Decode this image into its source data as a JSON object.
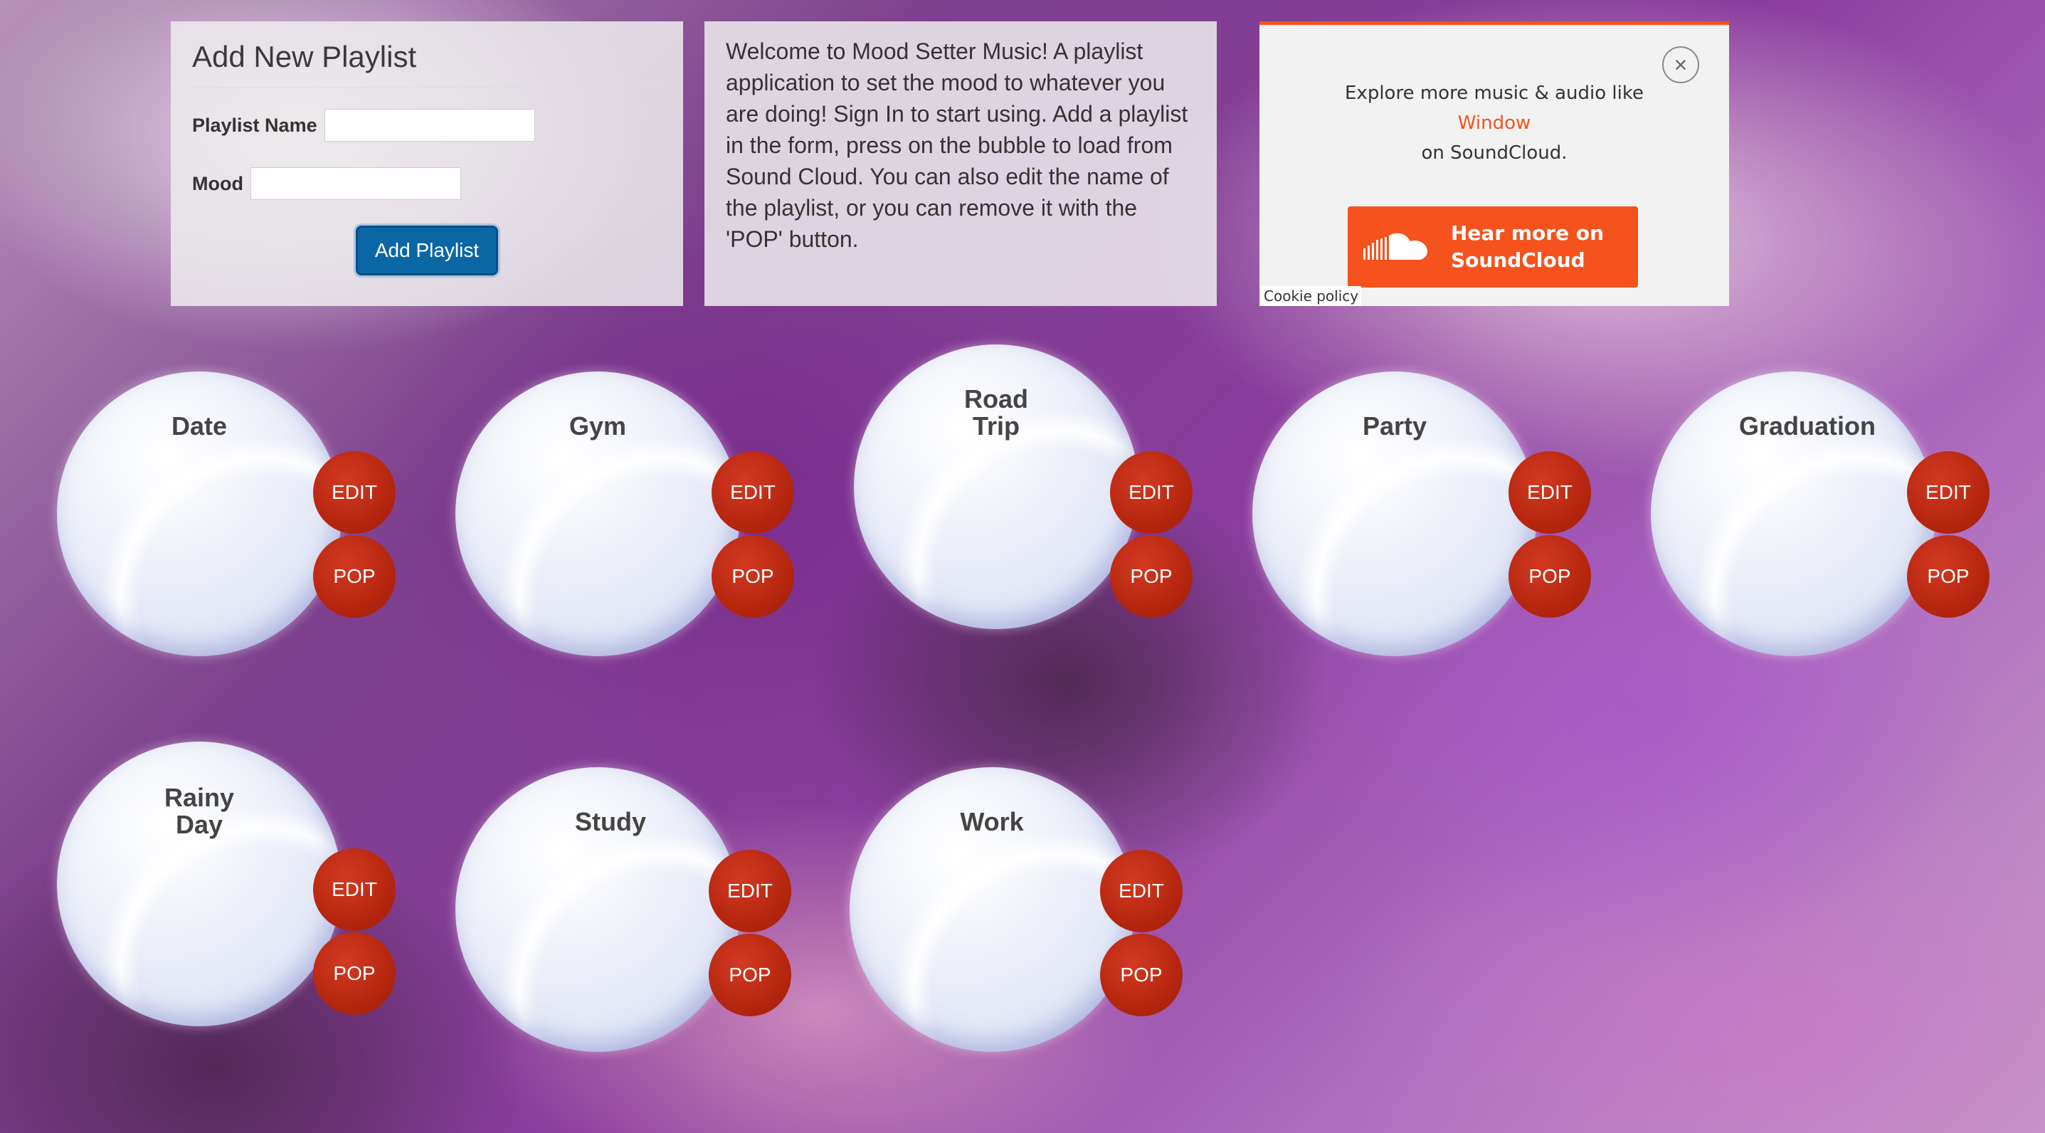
{
  "form": {
    "title": "Add New Playlist",
    "playlist_name_label": "Playlist Name",
    "playlist_name_value": "",
    "mood_label": "Mood",
    "mood_value": "",
    "add_button": "Add Playlist"
  },
  "info": {
    "text": "Welcome to Mood Setter Music! A playlist application to set the mood to whatever you are doing! Sign In to start using. Add a playlist in the form, press on the bubble to load from Sound Cloud. You can also edit the name of the playlist, or you can remove it with the 'POP' button."
  },
  "soundcloud": {
    "close_glyph": "×",
    "line1": "Explore more music & audio like",
    "link": "Window",
    "line3": "on SoundCloud.",
    "button_line1": "Hear more on",
    "button_line2": "SoundCloud",
    "cookie": "Cookie policy",
    "accent_color": "#f5521d"
  },
  "bubbles": [
    {
      "label": "Date",
      "edit": "EDIT",
      "pop": "POP"
    },
    {
      "label": "Gym",
      "edit": "EDIT",
      "pop": "POP"
    },
    {
      "label": "Road\nTrip",
      "edit": "EDIT",
      "pop": "POP"
    },
    {
      "label": "Party",
      "edit": "EDIT",
      "pop": "POP"
    },
    {
      "label": "Graduation",
      "edit": "EDIT",
      "pop": "POP"
    },
    {
      "label": "Rainy\nDay",
      "edit": "EDIT",
      "pop": "POP"
    },
    {
      "label": "Study",
      "edit": "EDIT",
      "pop": "POP"
    },
    {
      "label": "Work",
      "edit": "EDIT",
      "pop": "POP"
    }
  ],
  "colors": {
    "button_blue": "#0a67a3",
    "bubble_button_red": "#b6260f"
  }
}
